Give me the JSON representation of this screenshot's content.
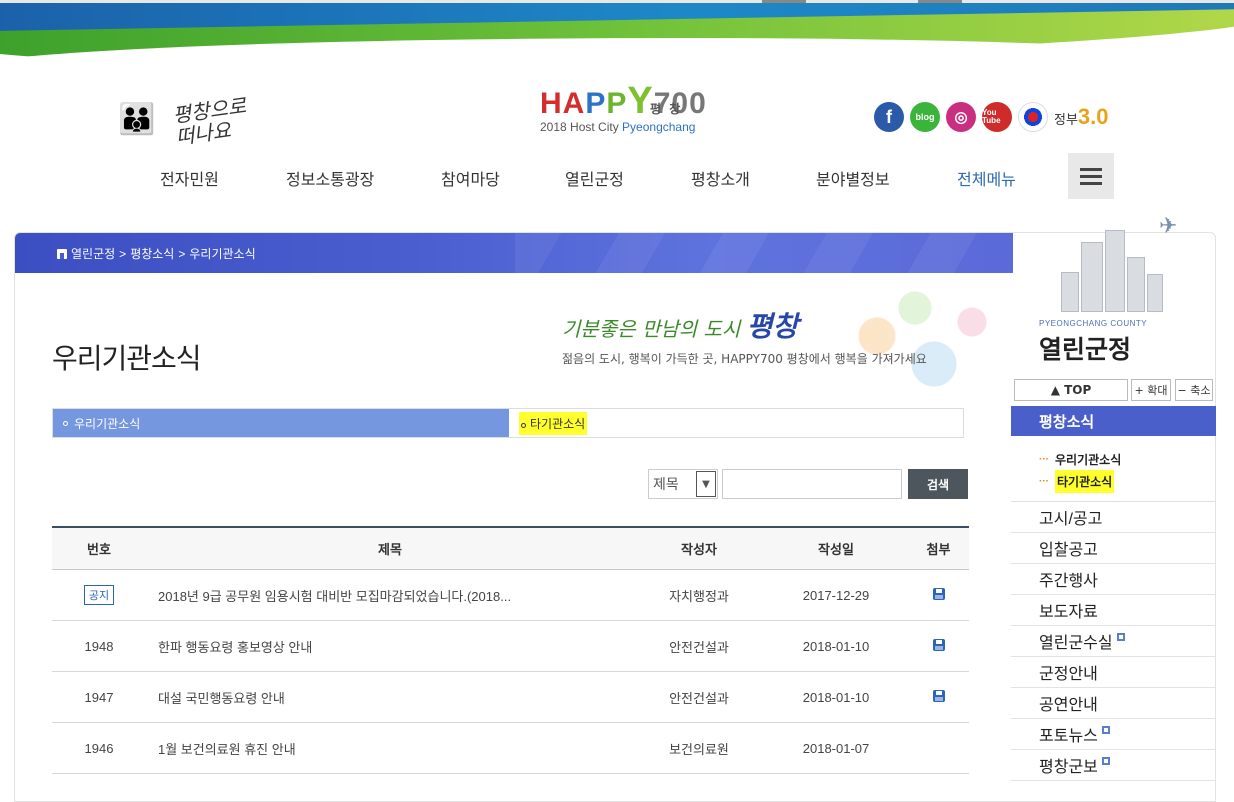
{
  "header": {
    "left_logo_text": "평창으로 떠나요",
    "center_logo": {
      "word": "HAPPY700",
      "korean": "평 창",
      "host_prefix": "2018 Host City",
      "host_city": "Pyeongchang"
    },
    "sns": {
      "facebook": "f",
      "blog": "blog",
      "instagram": "◎",
      "youtube": "You Tube",
      "gov_label": "정부",
      "gov_num": "3.0"
    }
  },
  "gnb": {
    "items": [
      "전자민원",
      "정보소통광장",
      "참여마당",
      "열린군정",
      "평창소개",
      "분야별정보",
      "전체메뉴"
    ]
  },
  "breadcrumb": {
    "items": [
      "열린군정",
      "평창소식",
      "우리기관소식"
    ],
    "sep": ">"
  },
  "page": {
    "title": "우리기관소식",
    "slogan_pre": "기분좋은 만남의 도시",
    "slogan_city": "평창",
    "slogan_sub": "젊음의 도시, 행복이 가득한 곳, HAPPY700 평창에서 행복을 가져가세요"
  },
  "subtabs": [
    {
      "label": "우리기관소식",
      "active": true
    },
    {
      "label": "타기관소식",
      "active": false
    }
  ],
  "search": {
    "select_value": "제목",
    "input_value": "",
    "button": "검색"
  },
  "board": {
    "headers": {
      "no": "번호",
      "title": "제목",
      "writer": "작성자",
      "date": "작성일",
      "file": "첨부"
    },
    "rows": [
      {
        "no": "공지",
        "title": "2018년 9급 공무원 임용시험 대비반 모집마감되었습니다.(2018...",
        "writer": "자치행정과",
        "date": "2017-12-29",
        "has_file": true
      },
      {
        "no": "1948",
        "title": "한파 행동요령 홍보영상 안내",
        "writer": "안전건설과",
        "date": "2018-01-10",
        "has_file": true
      },
      {
        "no": "1947",
        "title": "대설 국민행동요령 안내",
        "writer": "안전건설과",
        "date": "2018-01-10",
        "has_file": true
      },
      {
        "no": "1946",
        "title": "1월 보건의료원 휴진 안내",
        "writer": "보건의료원",
        "date": "2018-01-07",
        "has_file": false
      }
    ]
  },
  "sidebar": {
    "county": "PYEONGCHANG COUNTY",
    "section": "열린군정",
    "top_button": "▲ TOP",
    "zoom_in": "+ 확대",
    "zoom_out": "− 축소",
    "current": "평창소식",
    "sub_items": [
      "우리기관소식",
      "타기관소식"
    ],
    "menu": [
      {
        "label": "고시/공고",
        "external": false
      },
      {
        "label": "입찰공고",
        "external": false
      },
      {
        "label": "주간행사",
        "external": false
      },
      {
        "label": "보도자료",
        "external": false
      },
      {
        "label": "열린군수실",
        "external": true
      },
      {
        "label": "군정안내",
        "external": false
      },
      {
        "label": "공연안내",
        "external": false
      },
      {
        "label": "포토뉴스",
        "external": true
      },
      {
        "label": "평창군보",
        "external": true
      }
    ]
  },
  "colors": {
    "accent_blue": "#4b5fcb",
    "tab_blue": "#7497e0",
    "highlight": "#ffff2e",
    "board_line": "#3a4d63"
  }
}
